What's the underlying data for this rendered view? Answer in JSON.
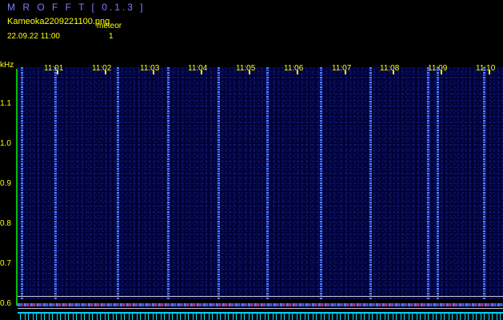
{
  "header": {
    "app_title": "M R O F F T [ 0.1.3 ]",
    "file_name": "Kameoka2209221100.png",
    "meteor_label": "meteor",
    "date_time": "22.09.22 11:00",
    "meteor_count": "1"
  },
  "axes": {
    "unit_label": "kHz",
    "y_ticks": [
      "1.1",
      "1.0",
      "0.9",
      "0.8",
      "0.7",
      "0.6"
    ],
    "x_ticks": [
      "11:01",
      "11:02",
      "11:03",
      "11:04",
      "11:05",
      "11:06",
      "11:07",
      "11:08",
      "11:09",
      "11:10"
    ]
  },
  "colors": {
    "text": "#ffff00",
    "title": "#7d7dff",
    "background": "#000000",
    "spectrogram_base": "#000033",
    "streak": "#5a8cff",
    "trace": "#00e0ff"
  }
}
